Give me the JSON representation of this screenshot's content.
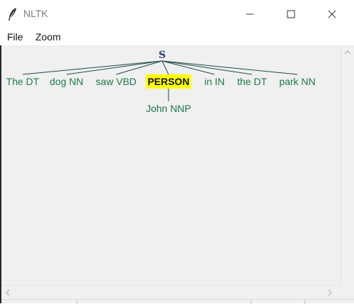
{
  "window": {
    "title": "NLTK",
    "icon": "feather-icon",
    "controls": [
      "minimize-icon",
      "maximize-icon",
      "close-icon"
    ]
  },
  "menubar": {
    "items": [
      {
        "label": "File"
      },
      {
        "label": "Zoom"
      }
    ]
  },
  "tree": {
    "root": "S",
    "leaves": [
      {
        "label": "The DT",
        "highlighted": false
      },
      {
        "label": "dog NN",
        "highlighted": false
      },
      {
        "label": "saw VBD",
        "highlighted": false
      },
      {
        "label": "PERSON",
        "highlighted": true
      },
      {
        "label": "in IN",
        "highlighted": false
      },
      {
        "label": "the DT",
        "highlighted": false
      },
      {
        "label": "park NN",
        "highlighted": false
      }
    ],
    "child_of_person": "John NNP"
  },
  "colors": {
    "tree_line": "#1e4a4a",
    "leaf_text": "#1a7a46",
    "root_text": "#2c3a8a",
    "highlight": "#ffff00",
    "canvas_bg": "#f0f0f0"
  }
}
